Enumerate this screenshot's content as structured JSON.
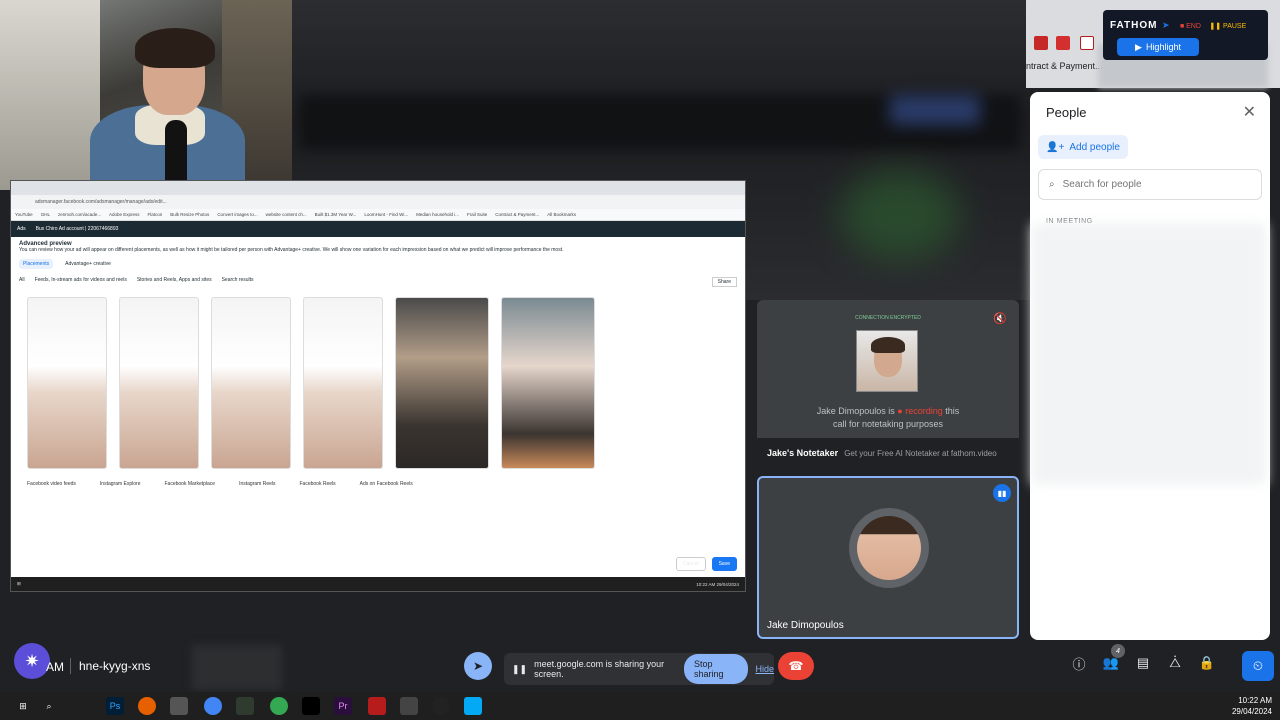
{
  "background": {
    "description_colors": {
      "panel": "#202124",
      "accent": "#1a73e8"
    }
  },
  "shared_screen": {
    "address": "adsmanager.facebook.com/adsmanager/manage/ads/edit...",
    "bookmarks": [
      "YouTube",
      "GHL",
      "zenmoh.com/acade...",
      "Adobe Express",
      "Flatcon",
      "Bulk Resize Photos",
      "Convert images to...",
      "website content ch...",
      "Built $1.3M Year W...",
      "LoomHunt - Find Wi...",
      "Median household i...",
      "Frail Suite",
      "Contract & Payment...",
      "All Bookmarks"
    ],
    "topbar_items": [
      "Ads",
      "Bux Chiro Ad account | 22067466893"
    ],
    "dialog_title": "Advanced preview",
    "dialog_desc": "You can review how your ad will appear on different placements, as well as how it might be tailored per person with Advantage+ creative. We will show one variation for each impression based on what we predict will improve performance the most.",
    "tabs": [
      "Placements",
      "Advantage+ creative"
    ],
    "filters": [
      "All",
      "Feeds, In-stream ads for videos and reels",
      "Stories and Reels, Apps and sites",
      "Search results"
    ],
    "share_label": "Share",
    "vary_label": "Vary aspect ratio",
    "placements": [
      "Facebook video feeds",
      "Instagram Explore",
      "Facebook Marketplace",
      "Instagram Reels",
      "Facebook Reels",
      "Ads on Facebook Reels"
    ],
    "thumb_caption": "Bax Chiropractic",
    "get_offer": "Get offer",
    "cancel_label": "Cancel",
    "save_label": "Save",
    "taskbar_time": "10:22 AM",
    "taskbar_date": "29/04/2024"
  },
  "notetaker_tile": {
    "encrypted": "CONNECTION ENCRYPTED",
    "msg_prefix": "Jake Dimopoulos is",
    "msg_rec": "recording",
    "msg_suffix": "this",
    "msg_line2": "call for notetaking purposes",
    "name": "Jake's Notetaker",
    "tagline": "Get your Free AI Notetaker at fathom.video"
  },
  "jake_tile": {
    "name": "Jake Dimopoulos"
  },
  "chrome_strip": {
    "partial_text": "ntract & Payment..."
  },
  "fathom": {
    "brand": "FATHOM",
    "end": "END",
    "pause": "PAUSE",
    "highlight": "Highlight"
  },
  "people": {
    "title": "People",
    "add_label": "Add people",
    "search_placeholder": "Search for people",
    "section": "IN MEETING"
  },
  "meet_bar": {
    "time": "AM",
    "meeting_code": "hne-kyyg-xns",
    "share_msg": "meet.google.com is sharing your screen.",
    "stop_label": "Stop sharing",
    "hide_label": "Hide",
    "people_count": "4"
  },
  "win_taskbar": {
    "time": "10:22 AM",
    "date": "29/04/2024"
  }
}
